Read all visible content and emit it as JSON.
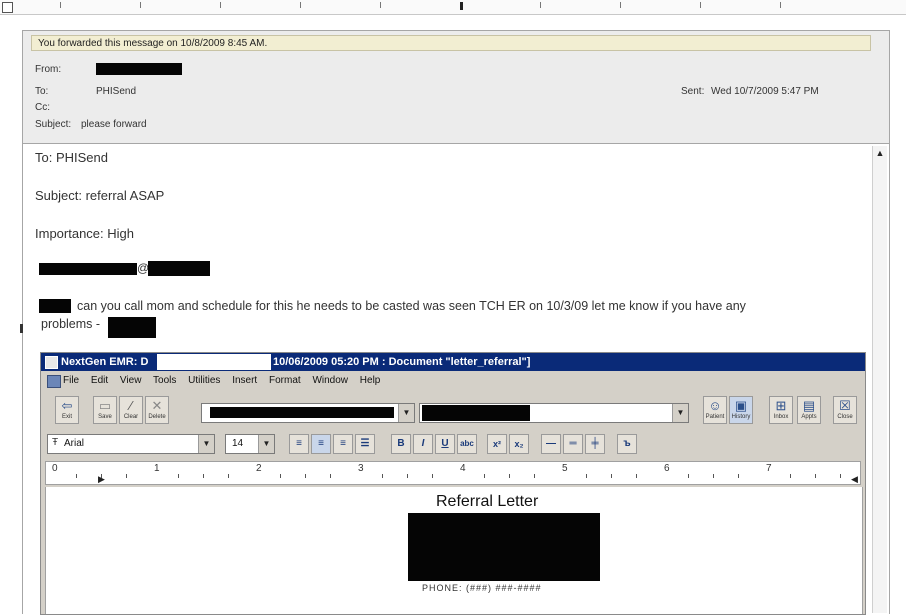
{
  "email": {
    "forward_note": "You forwarded this message on 10/8/2009 8:45 AM.",
    "header": {
      "from_label": "From:",
      "to_label": "To:",
      "to_value": "PHISend",
      "cc_label": "Cc:",
      "subject_label": "Subject:",
      "subject_value": "please forward",
      "sent_label": "Sent:",
      "sent_value": "Wed 10/7/2009 5:47 PM"
    },
    "body": {
      "to_line": "To: PHISend",
      "subject_line": "Subject: referral ASAP",
      "importance_line": "Importance: High",
      "email_fragment": "@",
      "message_text": "can you call mom and schedule for this he needs to be casted was seen TCH ER on 10/3/09 let me know if you have any",
      "message_cont": "problems -"
    }
  },
  "emr": {
    "title_app": "NextGen EMR: D",
    "title_rest": "10/06/2009 05:20 PM : Document \"letter_referral\"]",
    "menu": [
      "File",
      "Edit",
      "View",
      "Tools",
      "Utilities",
      "Insert",
      "Format",
      "Window",
      "Help"
    ],
    "toolbar_left": [
      {
        "label": "Exit",
        "icon": "exit-icon"
      },
      {
        "label": "Save",
        "icon": "save-icon"
      },
      {
        "label": "Clear",
        "icon": "clear-icon"
      },
      {
        "label": "Delete",
        "icon": "delete-icon"
      }
    ],
    "toolbar_right": [
      {
        "label": "Patient",
        "icon": "patient-icon"
      },
      {
        "label": "History",
        "icon": "history-icon"
      },
      {
        "label": "Inbox",
        "icon": "inbox-icon"
      },
      {
        "label": "Appts",
        "icon": "appointments-icon"
      },
      {
        "label": "Close",
        "icon": "close-icon"
      }
    ],
    "font_name": "Arial",
    "font_size": "14",
    "ruler_numbers": [
      "0",
      "1",
      "2",
      "3",
      "4",
      "5",
      "6",
      "7"
    ],
    "doc_title": "Referral Letter",
    "doc_partial": "PHONE: (###) ###-####"
  },
  "colors": {
    "title_bar": "#0a2a78",
    "redaction": "#050505",
    "note_bg": "#f2eed2"
  }
}
